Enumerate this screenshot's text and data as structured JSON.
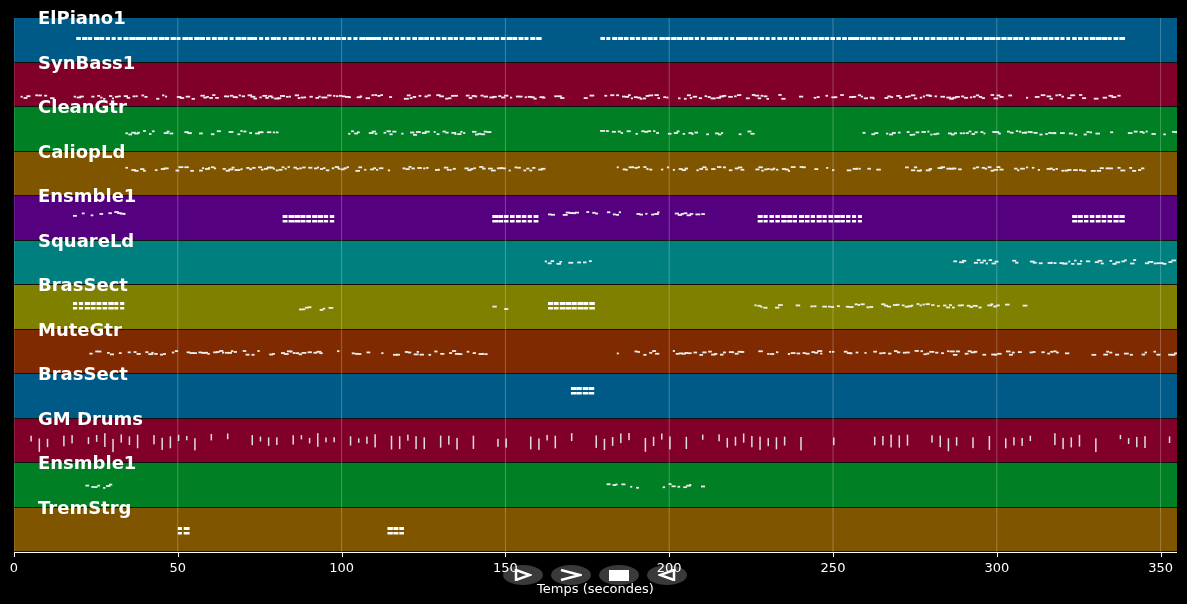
{
  "tracks": [
    {
      "name": "ElPiano1",
      "color": "#005a87"
    },
    {
      "name": "SynBass1",
      "color": "#80002a"
    },
    {
      "name": "CleanGtr",
      "color": "#007f24"
    },
    {
      "name": "CaliopLd",
      "color": "#7f5500"
    },
    {
      "name": "Ensmble1",
      "color": "#55007f"
    },
    {
      "name": "SquareLd",
      "color": "#007f7f"
    },
    {
      "name": "BrasSect",
      "color": "#7f7f00"
    },
    {
      "name": "MuteGtr",
      "color": "#7f2a00"
    },
    {
      "name": "BrasSect",
      "color": "#005a87"
    },
    {
      "name": "GM Drums",
      "color": "#80002a"
    },
    {
      "name": "Ensmble1",
      "color": "#007f24"
    },
    {
      "name": "TremStrg",
      "color": "#7f5500"
    }
  ],
  "x_axis": {
    "label": "Temps (secondes)",
    "ticks": [
      "0",
      "50",
      "100",
      "150",
      "200",
      "250",
      "300",
      "350"
    ]
  },
  "playback_buttons": [
    {
      "kind": "play"
    },
    {
      "kind": "forward"
    },
    {
      "kind": "stop"
    },
    {
      "kind": "back"
    }
  ]
}
